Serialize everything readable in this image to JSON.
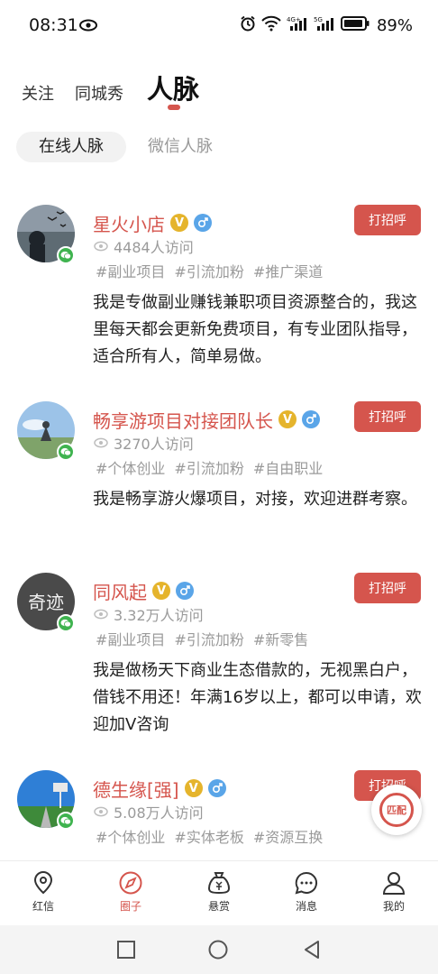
{
  "status_bar": {
    "time": "08:31",
    "battery": "89%"
  },
  "top_tabs": {
    "follow": "关注",
    "city_show": "同城秀",
    "network": "人脉"
  },
  "sub_tabs": {
    "online": "在线人脉",
    "wechat": "微信人脉"
  },
  "greet_label": "打招呼",
  "accent_color": "#d5554d",
  "cards": [
    {
      "name": "星火小店",
      "visits": "4484人访问",
      "tags": [
        "#副业项目",
        "#引流加粉",
        "#推广渠道"
      ],
      "bio": "我是专做副业赚钱兼职项目资源整合的，我这里每天都会更新免费项目，有专业团队指导，适合所有人，简单易做。"
    },
    {
      "name": "畅享游项目对接团队长",
      "visits": "3270人访问",
      "tags": [
        "#个体创业",
        "#引流加粉",
        "#自由职业"
      ],
      "bio": "我是畅享游火爆项目，对接，欢迎进群考察。"
    },
    {
      "name": "同风起",
      "visits": "3.32万人访问",
      "tags": [
        "#副业项目",
        "#引流加粉",
        "#新零售"
      ],
      "bio": "我是做杨天下商业生态借款的，无视黑白户，借钱不用还！年满16岁以上，都可以申请，欢迎加V咨询",
      "avatar_text": "奇迹"
    },
    {
      "name": "德生缘[强]",
      "visits": "5.08万人访问",
      "tags": [
        "#个体创业",
        "#实体老板",
        "#资源互换"
      ],
      "bio": ""
    }
  ],
  "match_label": "匹配",
  "bottom_nav": {
    "hongxin": "红信",
    "circle": "圈子",
    "reward": "悬赏",
    "messages": "消息",
    "mine": "我的"
  }
}
